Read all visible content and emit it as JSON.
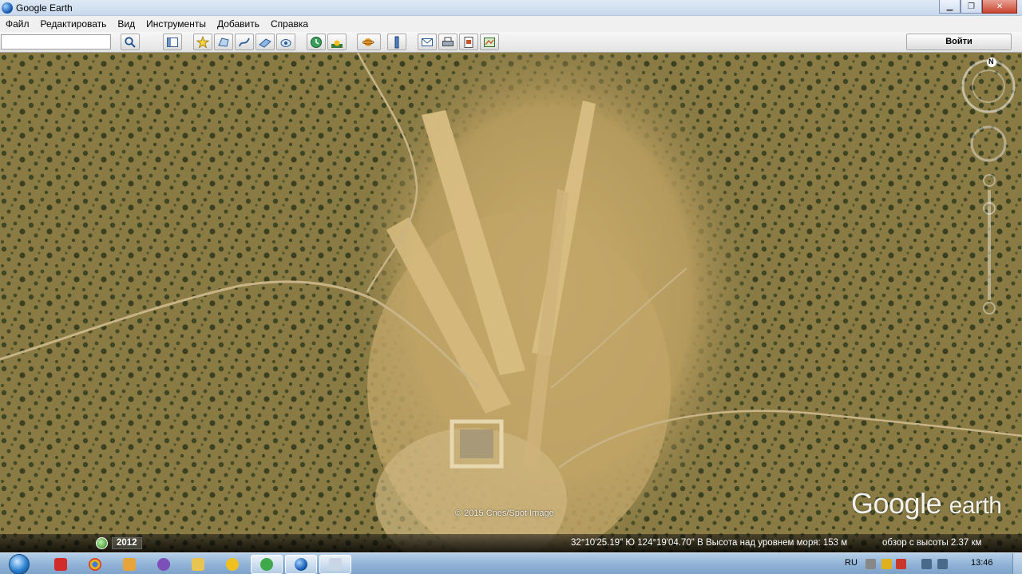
{
  "window": {
    "title": "Google Earth"
  },
  "menu": [
    "Файл",
    "Редактировать",
    "Вид",
    "Инструменты",
    "Добавить",
    "Справка"
  ],
  "toolbar": {
    "search_value": "",
    "login_label": "Войти"
  },
  "map": {
    "imagery_credit": "© 2015 Cnes/Spot Image",
    "logo_google": "Google",
    "logo_earth": "earth",
    "compass_north": "N"
  },
  "status": {
    "year": "2012",
    "coordinates": "32°10'25.19\" Ю  124°19'04.70\" В  Высота над уровнем моря:   153 м",
    "eye_altitude": "обзор с высоты   2.37 км"
  },
  "taskbar": {
    "language": "RU",
    "time": "13:46"
  },
  "colors": {
    "title_bar": "#c9d9ec",
    "close_button": "#c8442f",
    "terrain": "#7d7040",
    "clearing": "#c9ad6f",
    "shrub": "#37401f",
    "stripe": "#d8bd82"
  }
}
